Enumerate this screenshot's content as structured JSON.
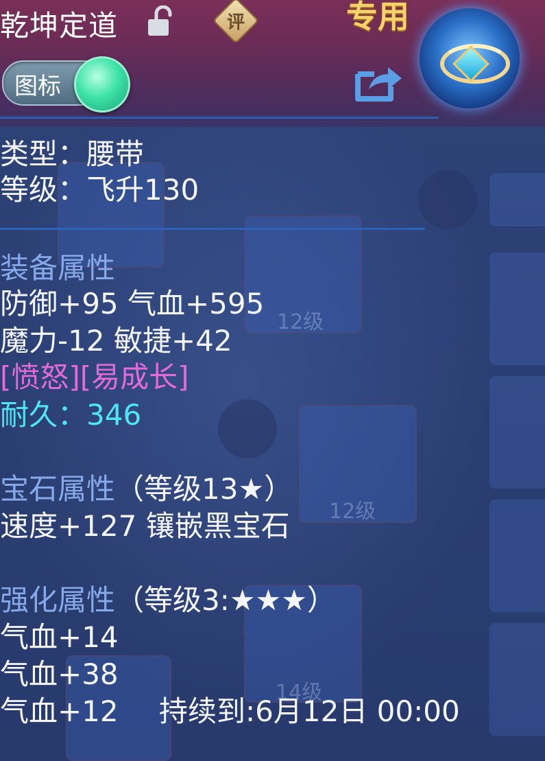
{
  "header": {
    "title": "乾坤定道",
    "rate_label": "评",
    "exclusive_label": "专用",
    "icon_toggle_label": "图标"
  },
  "basic": {
    "type_line": "类型：腰带",
    "level_line": "等级：飞升130"
  },
  "equip_attr": {
    "heading": "装备属性",
    "line1": "防御+95 气血+595",
    "line2": "魔力-12 敏捷+42",
    "specials": "[愤怒][易成长]",
    "durability": "耐久：346"
  },
  "gem_attr": {
    "heading": "宝石属性",
    "heading_suffix": "（等级13★）",
    "line1": "速度+127 镶嵌黑宝石"
  },
  "enhance_attr": {
    "heading": "强化属性",
    "heading_suffix": "（等级3:★★★）",
    "line1": "气血+14",
    "line2": "气血+38",
    "line3": "气血+12",
    "expire": "持续到:6月12日 00:00"
  },
  "background_slots": {
    "slot1_level": "12级",
    "slot2_level": "12级",
    "slot3_level": "14级"
  },
  "colors": {
    "section": "#86a9ea",
    "special": "#e26ad9",
    "durability": "#4fe6f2",
    "exclusive": "#f6d36a"
  }
}
